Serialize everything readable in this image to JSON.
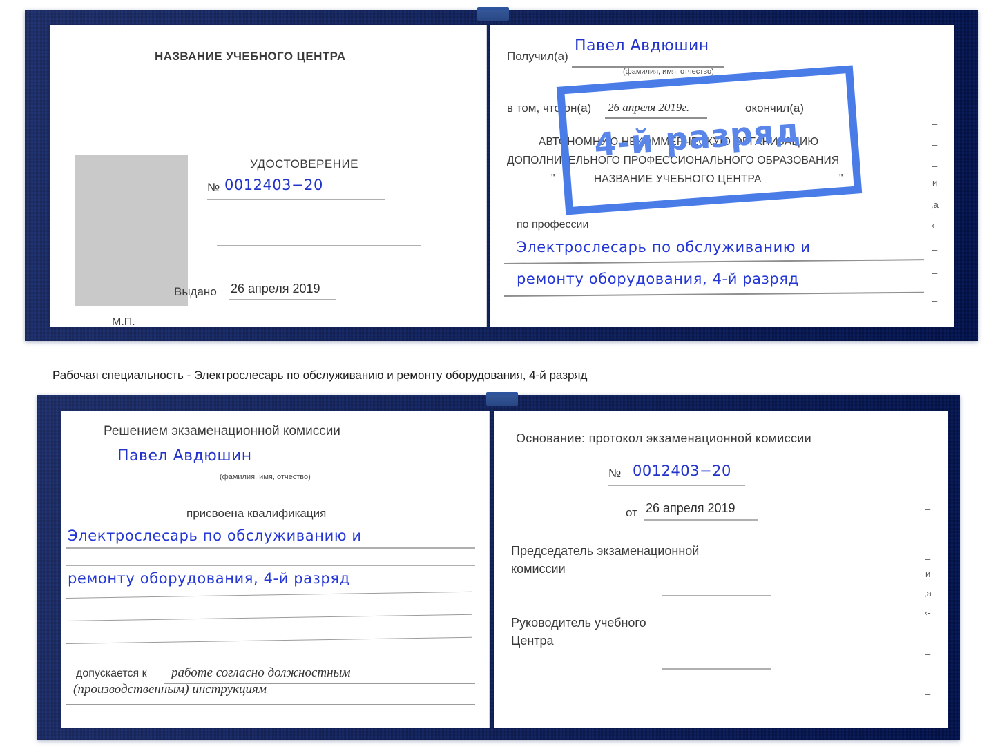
{
  "document": {
    "type": "certificate-booklet",
    "language": "ru"
  },
  "caption": {
    "text": "Рабочая специальность - Электрослесарь по обслуживанию и ремонту оборудования, 4-й разряд"
  },
  "watermark": {
    "text": "4-й разряд",
    "color": "#5a86ea",
    "border_color": "#4a7ce8"
  },
  "top_book": {
    "left_page": {
      "title": "НАЗВАНИЕ УЧЕБНОГО ЦЕНТРА",
      "doc_label": "УДОСТОВЕРЕНИЕ",
      "number_symbol": "№",
      "number_value": "0012403−20",
      "issued_label": "Выдано",
      "issued_value": "26 апреля 2019",
      "seal_label": "М.П.",
      "photo_placeholder": "photo-placeholder"
    },
    "right_page": {
      "received_label": "Получил(а)",
      "received_value": "Павел Авдюшин",
      "fio_hint": "(фамилия, имя, отчество)",
      "clause_label": "в том, что он(а)",
      "clause_date": "26 апреля 2019г.",
      "clause_tail": "окончил(а)",
      "org_line1": "АВТОНОМНУЮ НЕКОММЕРЧЕСКУЮ ОРГАНИЗАЦИЮ",
      "org_line2": "ДОПОЛНИТЕЛЬНОГО ПРОФЕССИОНАЛЬНОГО ОБРАЗОВАНИЯ",
      "org_quote_open": "\"",
      "org_line3": "НАЗВАНИЕ УЧЕБНОГО ЦЕНТРА",
      "org_quote_close": "\"",
      "profession_label": "по профессии",
      "profession_line1": "Электрослесарь по обслуживанию и",
      "profession_line2": "ремонту оборудования, 4-й разряд",
      "edge_fragments": [
        "–",
        "–",
        "–",
        "и",
        ",а",
        "‹-",
        "–",
        "–",
        "–"
      ]
    }
  },
  "bottom_book": {
    "left_page": {
      "heading": "Решением экзаменационной комиссии",
      "name_value": "Павел Авдюшин",
      "fio_hint": "(фамилия, имя, отчество)",
      "qualification_label": "присвоена квалификация",
      "qualification_line1": "Электрослесарь по обслуживанию и",
      "qualification_line2": "ремонту оборудования, 4-й разряд",
      "admitted_label": "допускается к",
      "admitted_line1": "работе согласно должностным",
      "admitted_line2": "(производственным) инструкциям"
    },
    "right_page": {
      "basis_label": "Основание: протокол экзаменационной комиссии",
      "number_symbol": "№",
      "number_value": "0012403−20",
      "date_label": "от",
      "date_value": "26 апреля 2019",
      "chairman_line1": "Председатель экзаменационной",
      "chairman_line2": "комиссии",
      "director_line1": "Руководитель учебного",
      "director_line2": "Центра",
      "edge_fragments": [
        "–",
        "–",
        "–",
        "и",
        ",а",
        "‹-",
        "–",
        "–",
        "–",
        "–"
      ]
    }
  }
}
